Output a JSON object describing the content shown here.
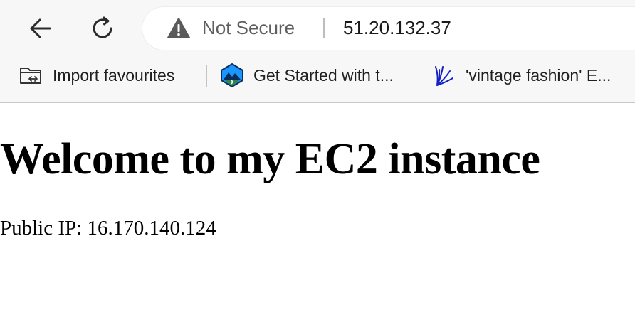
{
  "browser": {
    "security_status": "Not Secure",
    "url": "51.20.132.37",
    "icons": {
      "back": "back-arrow-icon",
      "reload": "reload-icon",
      "warning": "warning-triangle-icon"
    }
  },
  "bookmarks": [
    {
      "label": "Import favourites",
      "icon": "import-folder-icon"
    },
    {
      "label": "Get Started with t...",
      "icon": "trailhead-icon"
    },
    {
      "label": "'vintage fashion' E...",
      "icon": "brush-strokes-icon"
    }
  ],
  "page": {
    "heading": "Welcome to my EC2 instance",
    "ip_line": "Public IP: 16.170.140.124"
  }
}
